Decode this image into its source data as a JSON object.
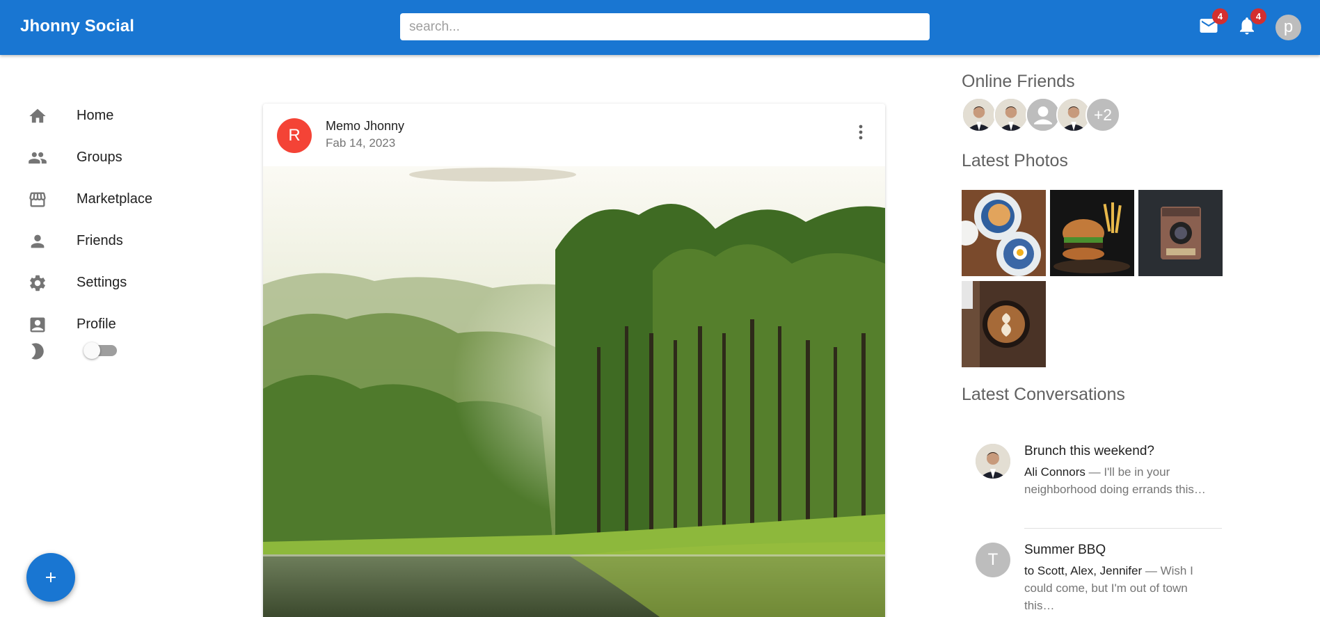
{
  "app": {
    "title": "Jhonny Social"
  },
  "search": {
    "placeholder": "search..."
  },
  "topbar": {
    "mail_icon": "mail-icon",
    "mail_count": "4",
    "notifications_icon": "bell-icon",
    "notifications_count": "4",
    "user_initial": "p"
  },
  "sidebar": {
    "items": [
      {
        "label": "Home",
        "icon": "home-icon"
      },
      {
        "label": "Groups",
        "icon": "groups-icon"
      },
      {
        "label": "Marketplace",
        "icon": "storefront-icon"
      },
      {
        "label": "Friends",
        "icon": "person-icon"
      },
      {
        "label": "Settings",
        "icon": "gear-icon"
      },
      {
        "label": "Profile",
        "icon": "account-box-icon"
      }
    ],
    "dark_mode": {
      "icon": "moon-icon",
      "enabled": false
    },
    "fab_icon": "plus-icon"
  },
  "post": {
    "avatar_initial": "R",
    "avatar_color": "#f44336",
    "author": "Memo Jhonny",
    "date": "Fab 14, 2023",
    "menu_icon": "more-vert-icon",
    "image": "forest-lake-photo"
  },
  "right": {
    "online_title": "Online Friends",
    "online_more": "+2",
    "photos_title": "Latest Photos",
    "photos": [
      "breakfast-plates-photo",
      "burger-fries-photo",
      "vintage-camera-photo",
      "latte-art-photo"
    ],
    "conversations_title": "Latest Conversations",
    "conversations": [
      {
        "title": "Brunch this weekend?",
        "who": "Ali Connors",
        "text": " — I'll be in your neighborhood doing errands this…",
        "avatar_initial": ""
      },
      {
        "title": "Summer BBQ",
        "who": "to Scott, Alex, Jennifer",
        "text": " — Wish I could come, but I'm out of town this…",
        "avatar_initial": "T"
      }
    ]
  },
  "colors": {
    "primary": "#1976d2",
    "badge": "#d32f2f",
    "avatar_grey": "#bdbdbd"
  }
}
